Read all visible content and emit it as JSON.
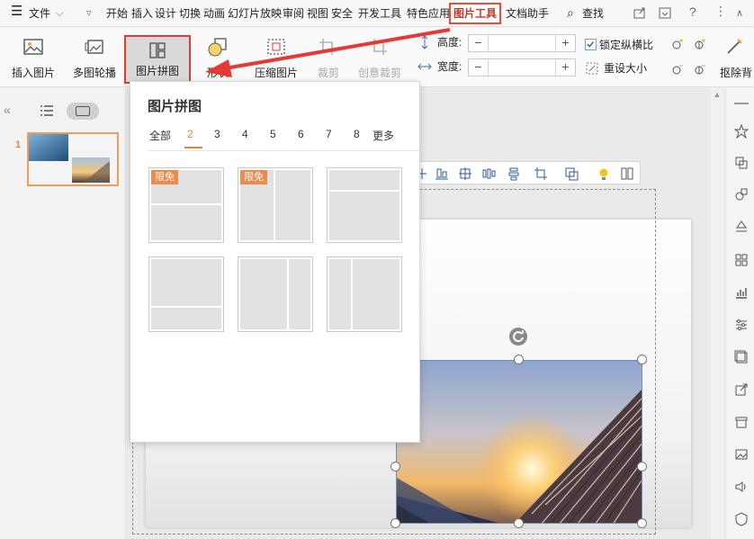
{
  "menubar": {
    "file_label": "文件",
    "items": [
      "开始",
      "插入",
      "设计",
      "切换",
      "动画",
      "幻灯片放映",
      "审阅",
      "视图",
      "安全",
      "开发工具",
      "特色应用"
    ],
    "active_tab": "图片工具",
    "after_active": "文档助手",
    "search_label": "查找"
  },
  "ribbon": {
    "insert_picture": "插入图片",
    "multi_carousel": "多图轮播",
    "picture_collage": "图片拼图",
    "shape": "形状",
    "compress": "压缩图片",
    "crop": "裁剪",
    "creative_crop": "创意裁剪",
    "height_label": "高度:",
    "width_label": "宽度:",
    "lock_ratio": "锁定纵横比",
    "reset_size": "重设大小",
    "remove_bg": "抠除背"
  },
  "left_panel": {
    "slide_number": "1"
  },
  "dropdown": {
    "title": "图片拼图",
    "tabs": [
      "全部",
      "2",
      "3",
      "4",
      "5",
      "6",
      "7",
      "8",
      "更多"
    ],
    "active_tab": "2",
    "badge": "限免"
  },
  "colors": {
    "accent": "#e8843a",
    "highlight_border": "#e53935",
    "badge_bg": "#ee8a4b"
  }
}
